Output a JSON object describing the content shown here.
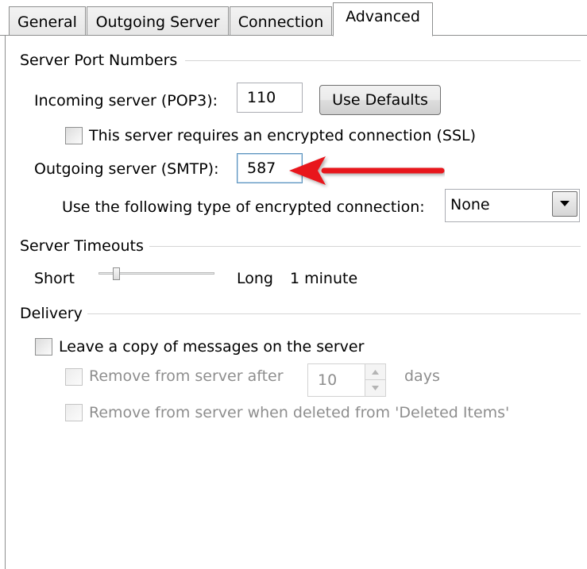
{
  "tabs": [
    {
      "label": "General"
    },
    {
      "label": "Outgoing Server"
    },
    {
      "label": "Connection"
    },
    {
      "label": "Advanced",
      "active": true
    }
  ],
  "ports": {
    "group_title": "Server Port Numbers",
    "incoming_label": "Incoming server (POP3):",
    "incoming_value": "110",
    "use_defaults_label": "Use Defaults",
    "ssl_label": "This server requires an encrypted connection (SSL)",
    "ssl_checked": false,
    "outgoing_label": "Outgoing server (SMTP):",
    "outgoing_value": "587",
    "encryption_label": "Use the following type of encrypted connection:",
    "encryption_value": "None"
  },
  "timeouts": {
    "group_title": "Server Timeouts",
    "short_label": "Short",
    "long_label": "Long",
    "value_label": "1 minute",
    "slider_fraction": 0.12
  },
  "delivery": {
    "group_title": "Delivery",
    "leave_copy_label": "Leave a copy of messages on the server",
    "leave_copy_checked": false,
    "remove_after_label": "Remove from server after",
    "remove_after_value": "10",
    "days_label": "days",
    "remove_deleted_label": "Remove from server when deleted from 'Deleted Items'"
  },
  "annotation": {
    "arrow_color": "#e8151b"
  }
}
